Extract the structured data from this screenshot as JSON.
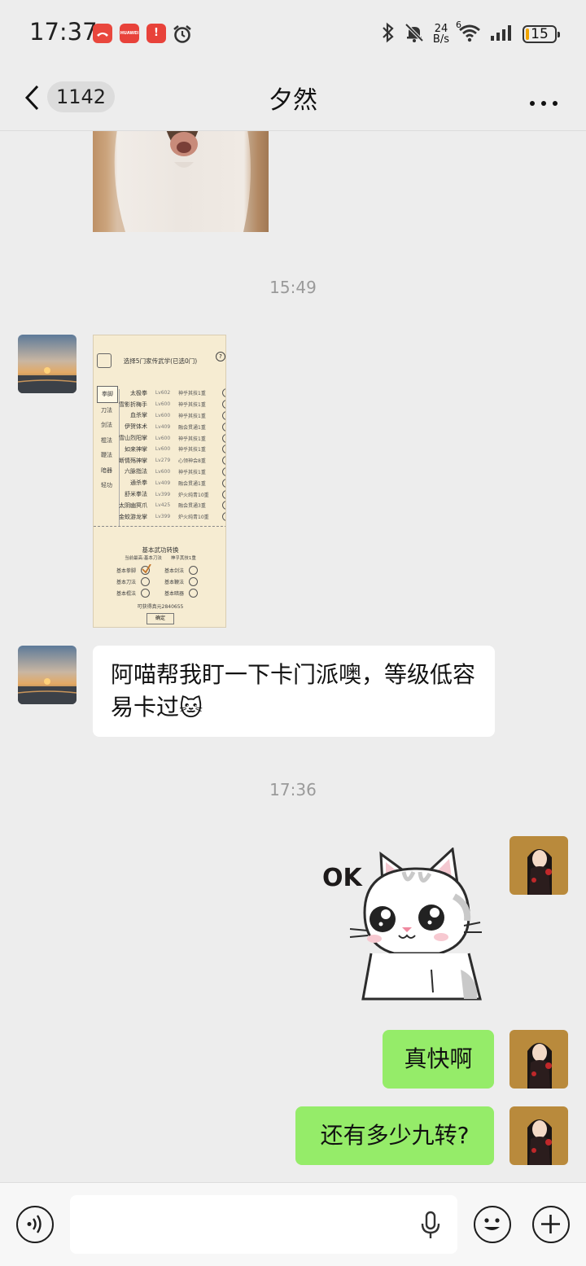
{
  "status_bar": {
    "time": "17:37",
    "net_speed_value": "24",
    "net_speed_unit": "B/s",
    "wifi_label": "6",
    "battery": "15",
    "notification_icons": [
      "missed-call-icon",
      "huawei-store-icon",
      "alert-app-icon",
      "alarm-clock-icon"
    ],
    "huawei_label": "HUAWEI",
    "alert_label": "!"
  },
  "header": {
    "unread_count": "1142",
    "title": "夕然"
  },
  "messages": {
    "ts_1": "15:49",
    "screenshot": {
      "title": "选择5门家传武学(已选0门)",
      "help": "?",
      "categories": [
        "拳脚",
        "刀法",
        "剑法",
        "棍法",
        "鞭法",
        "暗器",
        "轻功"
      ],
      "skills": [
        {
          "name": "太极拳",
          "level": "Lv602",
          "desc": "神乎其技1重"
        },
        {
          "name": "雪影折梅手",
          "level": "Lv600",
          "desc": "神乎其技1重"
        },
        {
          "name": "血杀掌",
          "level": "Lv600",
          "desc": "神乎其技1重"
        },
        {
          "name": "伊贺体术",
          "level": "Lv409",
          "desc": "融会贯通1重"
        },
        {
          "name": "雪山烈阳掌",
          "level": "Lv600",
          "desc": "神乎其技1重"
        },
        {
          "name": "如来神掌",
          "level": "Lv600",
          "desc": "神乎其技1重"
        },
        {
          "name": "断情殇神掌",
          "level": "Lv279",
          "desc": "心领神会8重"
        },
        {
          "name": "六脉指法",
          "level": "Lv600",
          "desc": "神乎其技1重"
        },
        {
          "name": "通杀拳",
          "level": "Lv409",
          "desc": "融会贯通1重"
        },
        {
          "name": "舒米拳法",
          "level": "Lv399",
          "desc": "炉火纯青10重"
        },
        {
          "name": "太阴幽冥爪",
          "level": "Lv425",
          "desc": "融会贯通3重"
        },
        {
          "name": "金蛟游龙掌",
          "level": "Lv399",
          "desc": "炉火纯青10重"
        }
      ],
      "convert_title": "基本武功转换",
      "convert_sub": "当前最高:基本刀法　　神乎其技1重",
      "options": [
        "基本拳脚",
        "基本剑法",
        "基本刀法",
        "基本鞭法",
        "基本棍法",
        "基本暗器"
      ],
      "reward": "可获得真元2840655",
      "confirm": "确定"
    },
    "text_in": "阿喵帮我盯一下卡门派噢，等级低容易卡过",
    "text_in_emoji": "🐱",
    "ts_2": "17:36",
    "sticker_text": "OK",
    "out_1": "真快啊",
    "out_2": "还有多少九转?"
  },
  "colors": {
    "out_bubble": "#95ec69",
    "in_bubble": "#ffffff",
    "background": "#ededed"
  }
}
